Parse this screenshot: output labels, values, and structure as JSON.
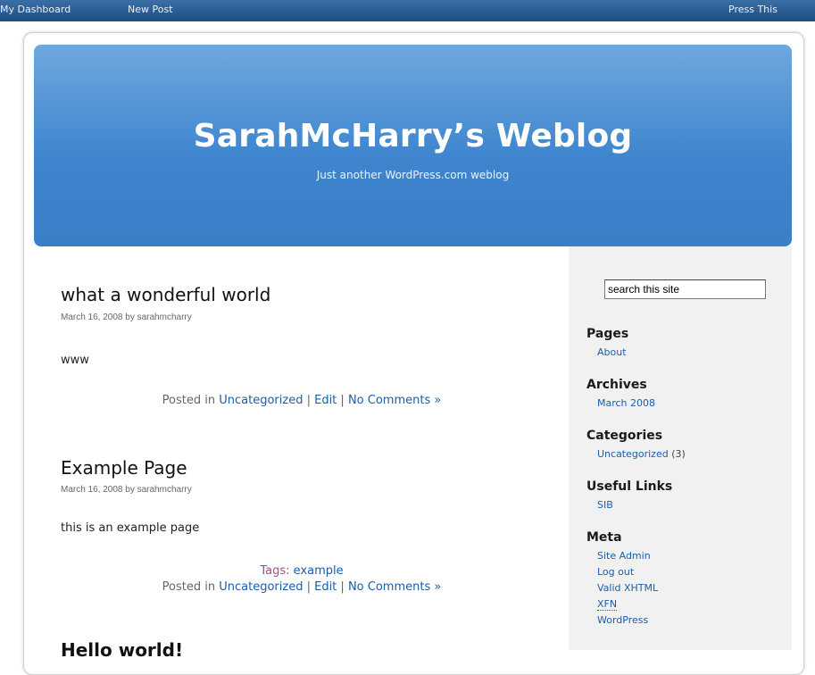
{
  "adminbar": {
    "dashboard": "My Dashboard",
    "new_post": "New Post",
    "press_this": "Press This"
  },
  "header": {
    "title": "SarahMcHarry’s Weblog",
    "tagline": "Just another WordPress.com weblog"
  },
  "posts": [
    {
      "title": "what a wonderful world",
      "meta": "March 16, 2008 by sarahmcharry",
      "body": "www",
      "posted_in": "Posted in",
      "category": "Uncategorized",
      "edit": "Edit",
      "comments": "No Comments »"
    },
    {
      "title": "Example Page",
      "meta": "March 16, 2008 by sarahmcharry",
      "body": "this is an example page",
      "tags_label": "Tags:",
      "tag": "example",
      "posted_in": "Posted in",
      "category": "Uncategorized",
      "edit": "Edit",
      "comments": "No Comments »"
    },
    {
      "title": "Hello world!"
    }
  ],
  "sidebar": {
    "search_value": "search this site",
    "pages": {
      "heading": "Pages",
      "items": [
        "About"
      ]
    },
    "archives": {
      "heading": "Archives",
      "items": [
        "March 2008"
      ]
    },
    "categories": {
      "heading": "Categories",
      "item": "Uncategorized",
      "count": "(3)"
    },
    "useful_links": {
      "heading": "Useful Links",
      "items": [
        "SIB"
      ]
    },
    "meta": {
      "heading": "Meta",
      "items": [
        "Site Admin",
        "Log out",
        "Valid XHTML",
        "XFN",
        "WordPress"
      ]
    }
  },
  "colors": {
    "header_blue": "#3f86cf",
    "link_blue": "#1a5ea8",
    "adminbar": "#1d4d82",
    "sidebar_bg": "#f1f1f1"
  }
}
